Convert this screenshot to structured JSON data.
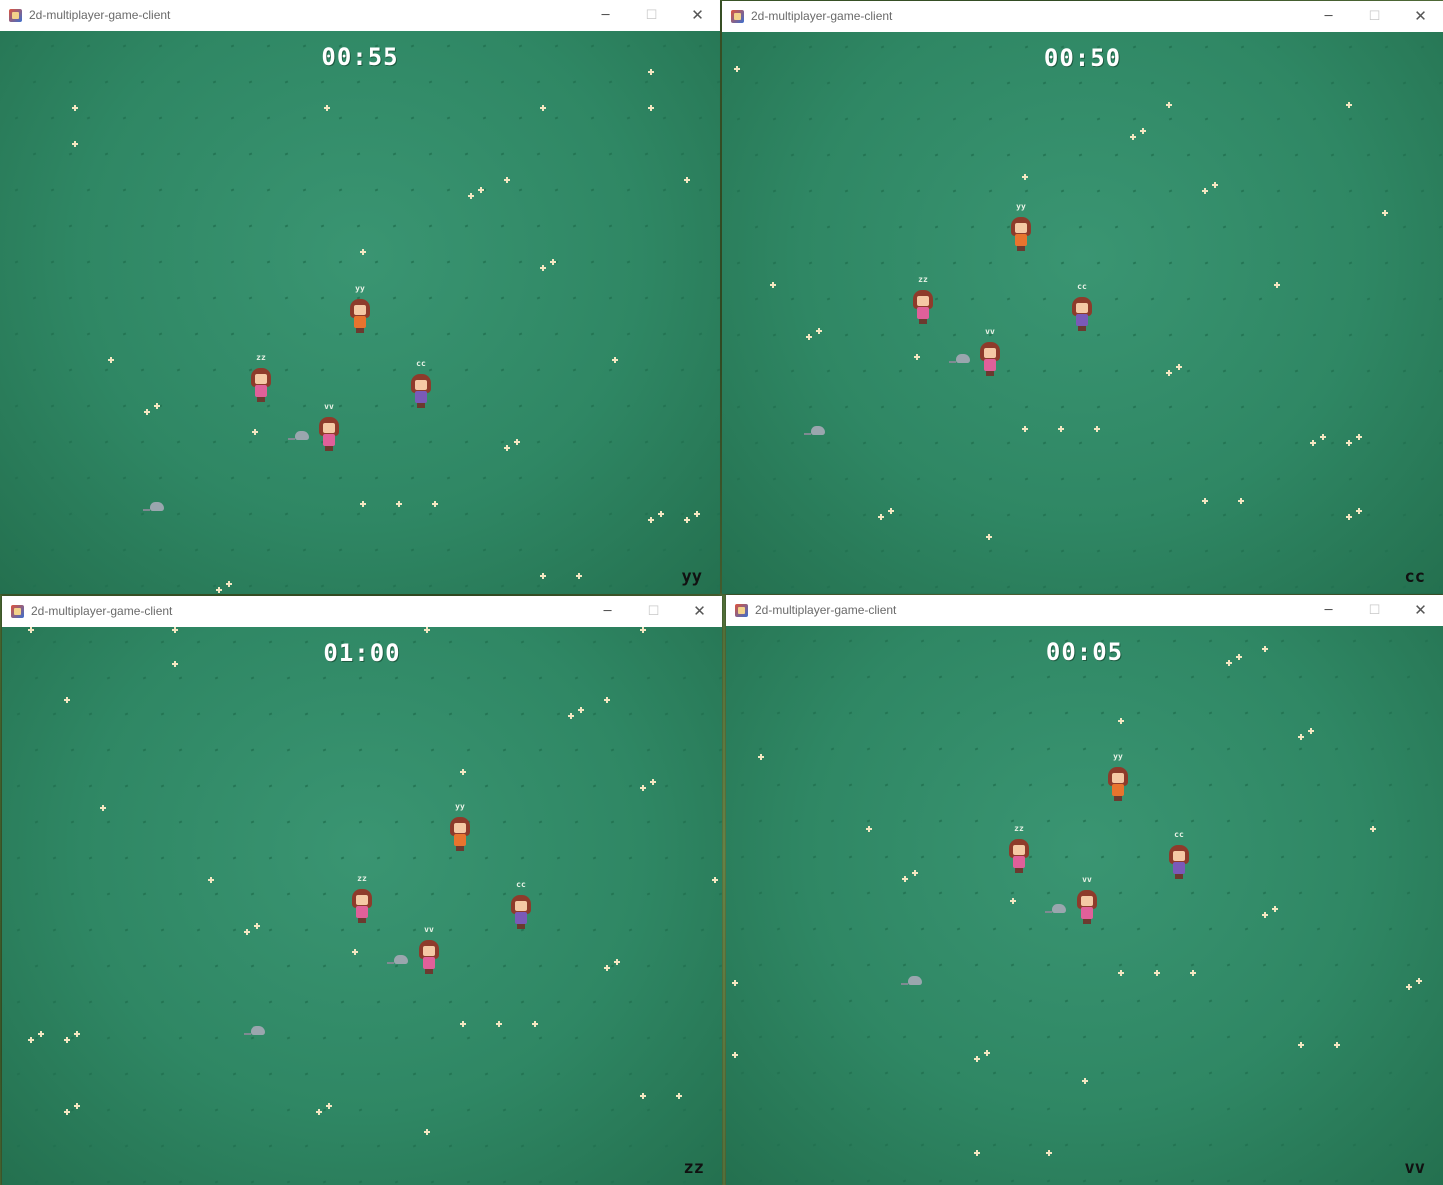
{
  "windows": [
    {
      "title": "2d-multiplayer-game-client",
      "timer": "00:55",
      "player_name": "yy",
      "players": [
        {
          "name": "yy",
          "color": "orange"
        },
        {
          "name": "zz",
          "color": "pink"
        },
        {
          "name": "vv",
          "color": "pink"
        },
        {
          "name": "cc",
          "color": "purple"
        }
      ]
    },
    {
      "title": "2d-multiplayer-game-client",
      "timer": "00:50",
      "player_name": "cc",
      "players": [
        {
          "name": "yy",
          "color": "orange"
        },
        {
          "name": "zz",
          "color": "pink"
        },
        {
          "name": "vv",
          "color": "pink"
        },
        {
          "name": "cc",
          "color": "purple"
        }
      ]
    },
    {
      "title": "2d-multiplayer-game-client",
      "timer": "01:00",
      "player_name": "zz",
      "players": [
        {
          "name": "yy",
          "color": "orange"
        },
        {
          "name": "zz",
          "color": "pink"
        },
        {
          "name": "vv",
          "color": "pink"
        },
        {
          "name": "cc",
          "color": "purple"
        }
      ]
    },
    {
      "title": "2d-multiplayer-game-client",
      "timer": "00:05",
      "player_name": "vv",
      "players": [
        {
          "name": "yy",
          "color": "orange"
        },
        {
          "name": "zz",
          "color": "pink"
        },
        {
          "name": "vv",
          "color": "pink"
        },
        {
          "name": "cc",
          "color": "purple"
        }
      ]
    }
  ],
  "icons": {
    "minimize": "minimize-icon",
    "maximize": "maximize-icon",
    "close": "close-icon"
  },
  "colors": {
    "grass": "#2f8764",
    "timer_text": "#ffffff",
    "player_name_text": "#111111",
    "orange": "#e8742e",
    "pink": "#e0609a",
    "purple": "#7a5ab8"
  }
}
